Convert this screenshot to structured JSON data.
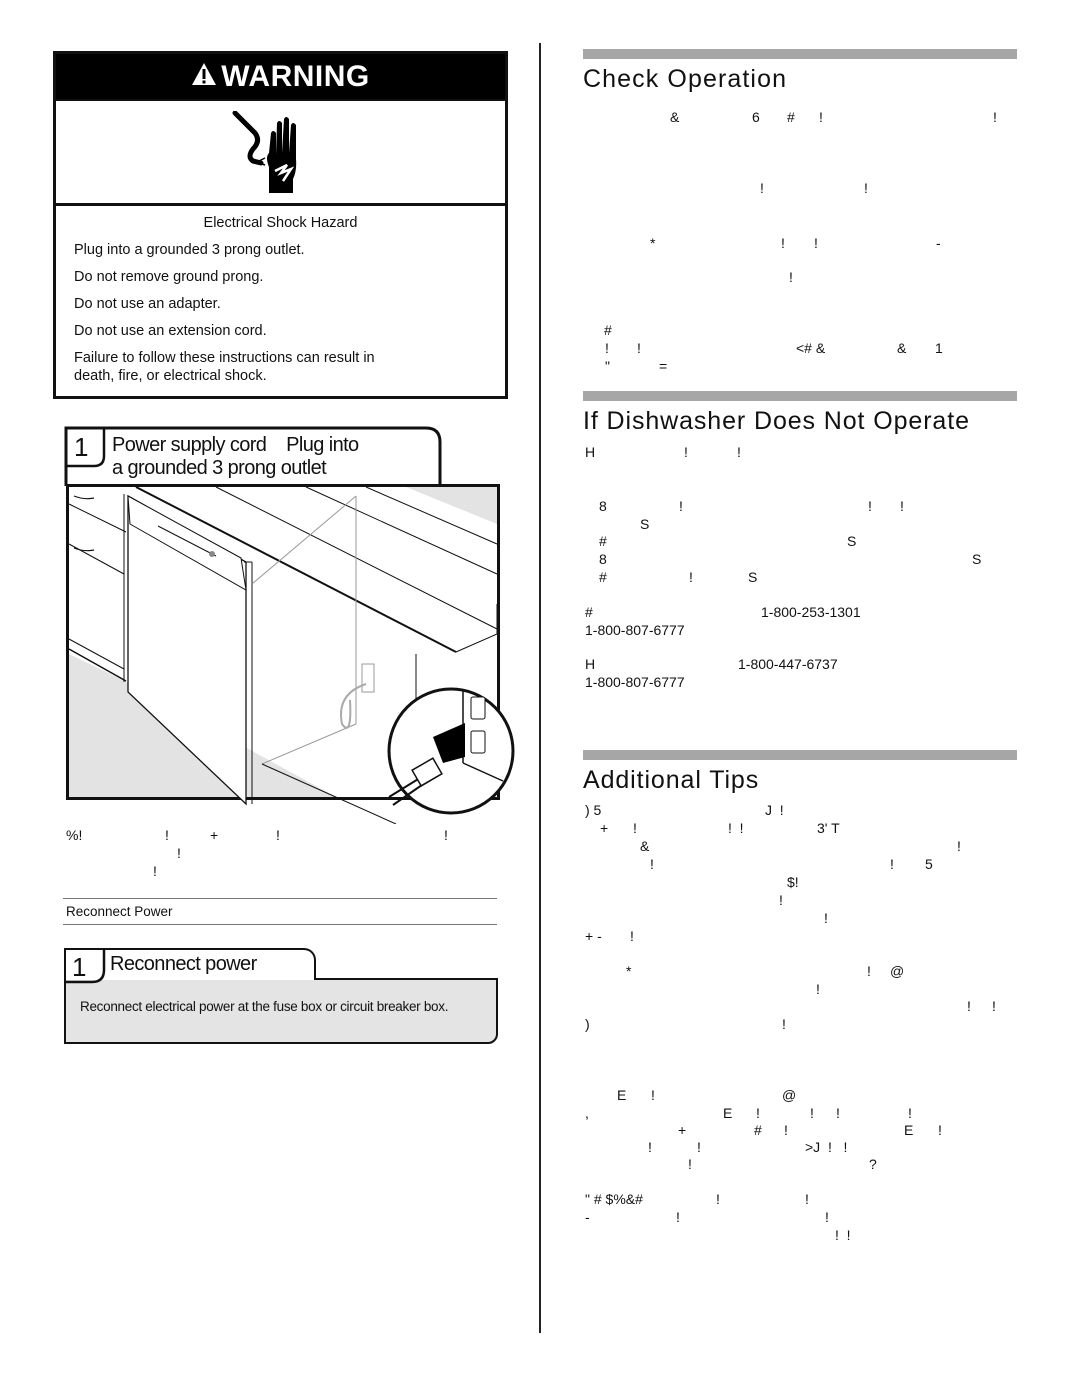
{
  "warning": {
    "header": "WARNING",
    "hazard_title": "Electrical Shock Hazard",
    "lines": [
      "Plug into a grounded 3 prong outlet.",
      "Do not remove ground prong.",
      "Do not use an adapter.",
      "Do not use an extension cord."
    ],
    "consequence": "Failure to follow these instructions can result in death, fire, or electrical shock."
  },
  "step_power_cord": {
    "number": "1",
    "title_line1": "Power supply cord    Plug into",
    "title_line2": "a grounded 3 prong outlet"
  },
  "left_body_garbled": [
    {
      "text": "%!",
      "row": 0,
      "col": 0
    },
    {
      "text": "!",
      "row": 0,
      "col": 1
    },
    {
      "text": "+",
      "row": 0,
      "col": 2
    },
    {
      "text": "!",
      "row": 0,
      "col": 3
    },
    {
      "text": "!",
      "row": 0,
      "col": 4
    },
    {
      "text": "!",
      "row": 1,
      "col": 0
    },
    {
      "text": "!",
      "row": 2,
      "col": 0
    }
  ],
  "reconnect_label": "Reconnect Power",
  "step_reconnect": {
    "number": "1",
    "title": "Reconnect power",
    "body": "Reconnect electrical power at the fuse box or circuit breaker box."
  },
  "check_operation": {
    "title": "Check Operation"
  },
  "not_operate": {
    "title": "If Dishwasher Does Not Operate",
    "phone_1": "1-800-253-1301",
    "phone_2": "1-800-807-6777",
    "phone_3": "1-800-447-6737",
    "phone_4": "1-800-807-6777"
  },
  "additional_tips": {
    "title": "Additional Tips"
  }
}
